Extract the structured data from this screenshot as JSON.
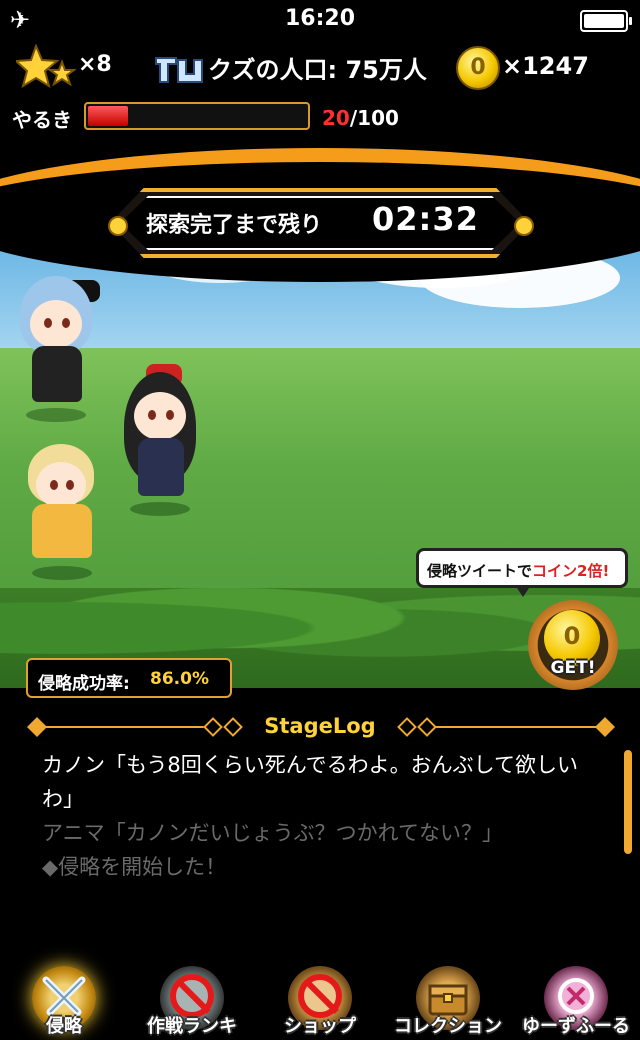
{
  "status_bar": {
    "time": "16:20",
    "airplane_icon": "airplane-icon",
    "battery_icon": "battery-icon"
  },
  "hud": {
    "stars": "×8",
    "population": "クズの人口: 75万人",
    "coin_symbol": "0",
    "coins": "×1247"
  },
  "yaruki": {
    "label": "やるき",
    "current": "20",
    "max": "/100",
    "fraction": 0.2
  },
  "timer": {
    "label": "探索完了まで残り",
    "value": "02:32"
  },
  "tweet_bubble": {
    "text_before": "侵略ツイートで",
    "text_red": "コイン2倍!"
  },
  "get_button": {
    "coin_symbol": "0",
    "label": "GET!"
  },
  "success_rate": {
    "label": "侵略成功率:",
    "value": "86.0%"
  },
  "stage_log": {
    "title": "StageLog",
    "lines": [
      "カノン「もう8回くらい死んでるわよ。おんぶして欲しいわ」",
      "アニマ「カノンだいじょうぶ？つかれてない？」",
      "◆侵略を開始した！"
    ]
  },
  "nav": [
    {
      "label": "侵略",
      "active": true,
      "disabled": false
    },
    {
      "label": "作戦ランキ",
      "active": false,
      "disabled": true
    },
    {
      "label": "ショップ",
      "active": false,
      "disabled": true
    },
    {
      "label": "コレクション",
      "active": false,
      "disabled": false
    },
    {
      "label": "ゆーずふーる",
      "active": false,
      "disabled": false
    }
  ],
  "colors": {
    "accent_orange": "#f59c1a",
    "gold": "#ffd23a",
    "red": "#e0201f"
  }
}
